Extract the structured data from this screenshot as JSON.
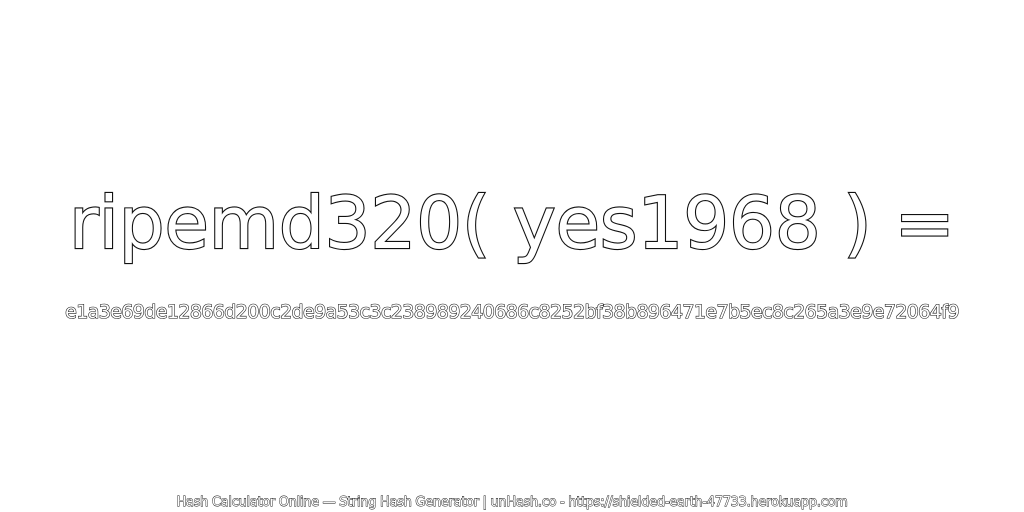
{
  "headline": {
    "text": "ripemd320( yes1968 ) ="
  },
  "digest": {
    "text": "e1a3e69de12866d200c2de9a53c3c238989240686c8252bf38b896471e7b5ec8c265a3e9e72064f9"
  },
  "footer": {
    "text": "Hash Calculator Online — String Hash Generator | unHash.co - https://shielded-earth-47733.herokuapp.com"
  },
  "colors": {
    "background": "#ffffff",
    "text_fill": "#ffffff",
    "text_outline": "#111111"
  }
}
